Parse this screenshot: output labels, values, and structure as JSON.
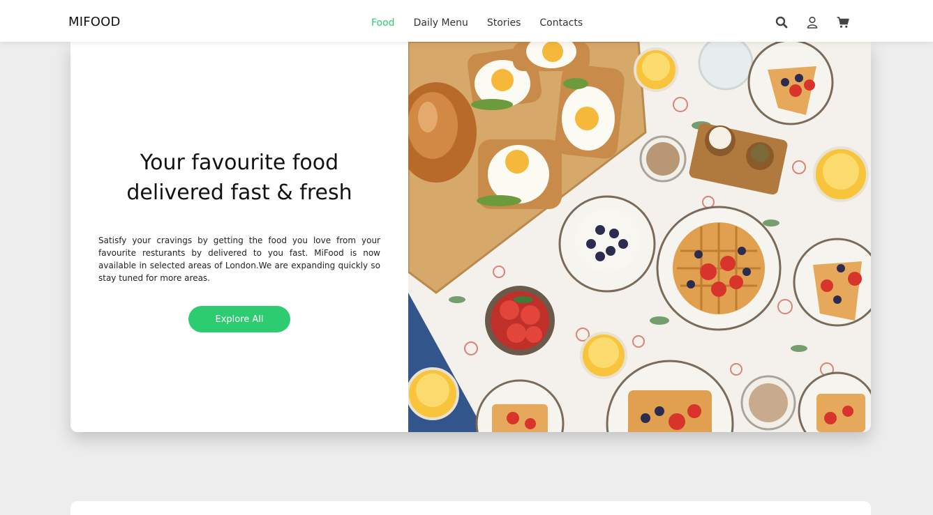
{
  "brand": "MIFOOD",
  "nav": {
    "links": [
      "Food",
      "Daily Menu",
      "Stories",
      "Contacts"
    ],
    "active": "Food"
  },
  "icons": [
    "search-icon",
    "user-icon",
    "cart-icon"
  ],
  "hero": {
    "title_line1": "Your favourite food",
    "title_line2": "delivered fast & fresh",
    "description": "Satisfy your cravings by getting the food you love from your favourite resturants by delivered to you fast. MiFood is now available in selected areas of London.We are expanding quickly so stay tuned for more areas.",
    "button_label": "Explore All"
  },
  "colors": {
    "accent": "#2ecc71",
    "background": "#ededed"
  }
}
